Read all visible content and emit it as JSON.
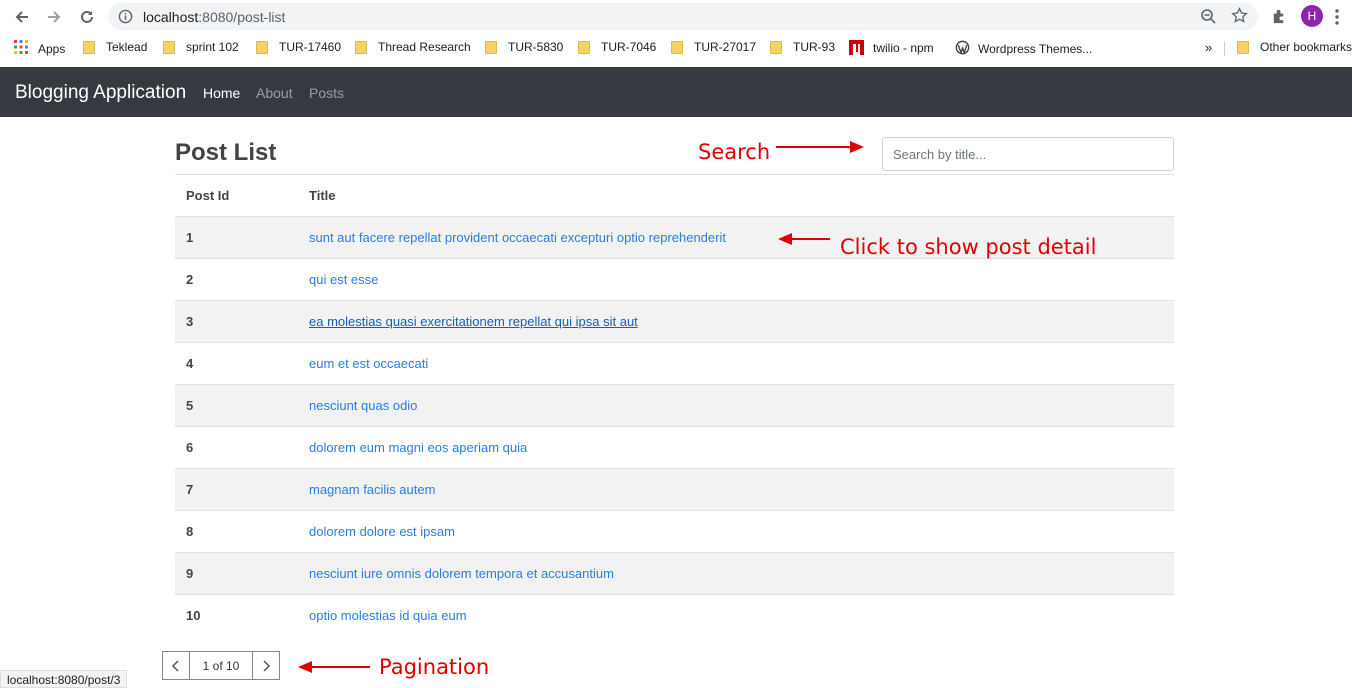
{
  "browser": {
    "url_host": "localhost",
    "url_path": ":8080/post-list",
    "profile_initial": "H",
    "bookmarks": [
      {
        "label": "Apps"
      },
      {
        "label": "Teklead"
      },
      {
        "label": "sprint 102"
      },
      {
        "label": "TUR-17460"
      },
      {
        "label": "Thread Research"
      },
      {
        "label": "TUR-5830"
      },
      {
        "label": "TUR-7046"
      },
      {
        "label": "TUR-27017"
      },
      {
        "label": "TUR-93"
      },
      {
        "label": "twilio - npm"
      },
      {
        "label": "Wordpress Themes..."
      },
      {
        "label": "Other bookmarks"
      }
    ],
    "overflow_label": "»",
    "status_url": "localhost:8080/post/3"
  },
  "navbar": {
    "brand": "Blogging Application",
    "links": [
      {
        "label": "Home",
        "active": true
      },
      {
        "label": "About",
        "active": false
      },
      {
        "label": "Posts",
        "active": false
      }
    ]
  },
  "main": {
    "title": "Post List",
    "search_placeholder": "Search by title...",
    "columns": [
      "Post Id",
      "Title"
    ],
    "rows": [
      {
        "id": "1",
        "title": "sunt aut facere repellat provident occaecati excepturi optio reprehenderit"
      },
      {
        "id": "2",
        "title": "qui est esse"
      },
      {
        "id": "3",
        "title": "ea molestias quasi exercitationem repellat qui ipsa sit aut"
      },
      {
        "id": "4",
        "title": "eum et est occaecati"
      },
      {
        "id": "5",
        "title": "nesciunt quas odio"
      },
      {
        "id": "6",
        "title": "dolorem eum magni eos aperiam quia"
      },
      {
        "id": "7",
        "title": "magnam facilis autem"
      },
      {
        "id": "8",
        "title": "dolorem dolore est ipsam"
      },
      {
        "id": "9",
        "title": "nesciunt iure omnis dolorem tempora et accusantium"
      },
      {
        "id": "10",
        "title": "optio molestias id quia eum"
      }
    ],
    "pagination": {
      "info": "1 of 10"
    }
  },
  "annotations": {
    "search": "Search",
    "detail": "Click to show post detail",
    "pagination": "Pagination"
  },
  "colors": {
    "annotation": "#e00000",
    "navbar": "#343a40",
    "link": "#2c7be5"
  }
}
